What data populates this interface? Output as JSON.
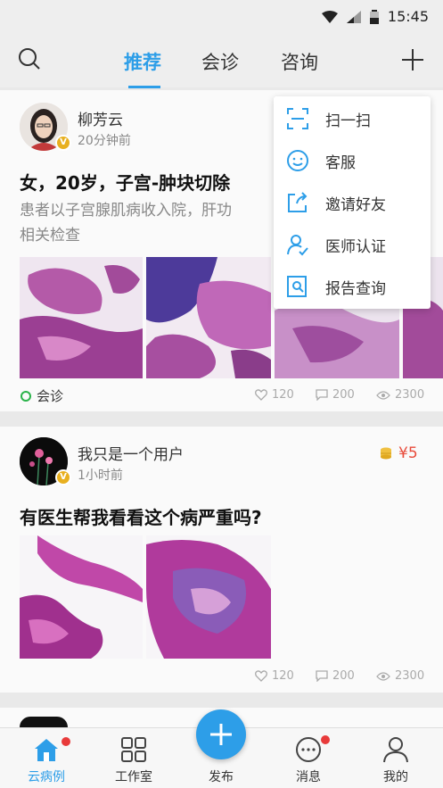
{
  "status": {
    "time": "15:45"
  },
  "tabs": [
    {
      "label": "推荐",
      "active": true
    },
    {
      "label": "会诊",
      "active": false
    },
    {
      "label": "咨询",
      "active": false
    }
  ],
  "menu": {
    "items": [
      {
        "label": "扫一扫",
        "icon": "scan-icon"
      },
      {
        "label": "客服",
        "icon": "smile-icon"
      },
      {
        "label": "邀请好友",
        "icon": "share-icon"
      },
      {
        "label": "医师认证",
        "icon": "user-verify-icon"
      },
      {
        "label": "报告查询",
        "icon": "report-search-icon"
      }
    ]
  },
  "posts": [
    {
      "author": "柳芳云",
      "time": "20分钟前",
      "title": "女，20岁，子宫-肿块切除",
      "desc_line1": "患者以子宫腺肌病收入院，肝功",
      "desc_line2": "相关检查",
      "tag": "会诊",
      "likes": "120",
      "comments": "200",
      "views": "2300"
    },
    {
      "author": "我只是一个用户",
      "time": "1小时前",
      "reward": "¥5",
      "title": "有医生帮我看看这个病严重吗?",
      "likes": "120",
      "comments": "200",
      "views": "2300"
    }
  ],
  "tabbar": [
    {
      "label": "云病例",
      "active": true
    },
    {
      "label": "工作室",
      "active": false
    },
    {
      "label": "发布",
      "active": false
    },
    {
      "label": "消息",
      "active": false
    },
    {
      "label": "我的",
      "active": false
    }
  ],
  "colors": {
    "accent": "#2d9ee8",
    "badge": "#e8b020",
    "reward": "#e84a3a",
    "tag": "#2bb34a"
  }
}
